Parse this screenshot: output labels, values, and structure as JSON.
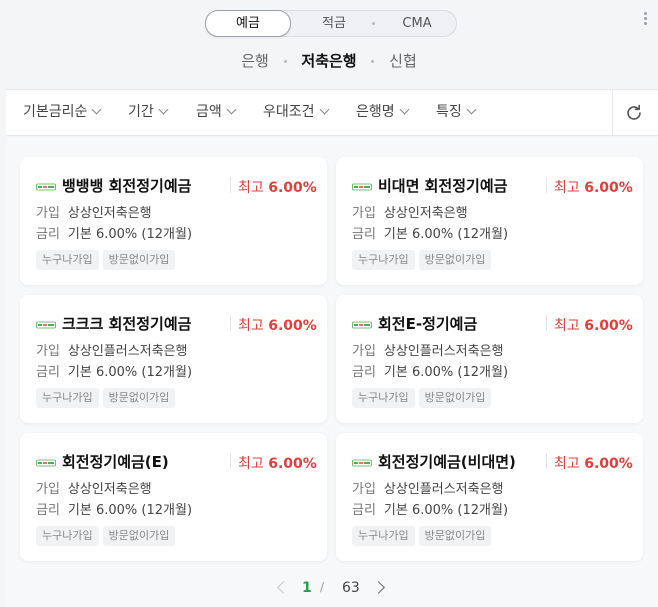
{
  "product_tabs": [
    {
      "label": "예금",
      "active": true
    },
    {
      "label": "적금",
      "active": false
    },
    {
      "label": "CMA",
      "active": false
    }
  ],
  "bank_types": [
    {
      "label": "은행",
      "selected": false
    },
    {
      "label": "저축은행",
      "selected": true
    },
    {
      "label": "신협",
      "selected": false
    }
  ],
  "filters": [
    "기본금리순",
    "기간",
    "금액",
    "우대조건",
    "은행명",
    "특징"
  ],
  "refresh_icon": "refresh-icon",
  "colors": {
    "accent_red": "#e0403a",
    "accent_green": "#2a9d4e"
  },
  "cards": [
    {
      "title": "뱅뱅뱅 회전정기예금",
      "rate_prefix": "최고",
      "rate": "6.00%",
      "join_label": "가입",
      "bank": "상상인저축은행",
      "rate_label": "금리",
      "base": "기본 6.00% (12개월)",
      "tags": [
        "누구나가입",
        "방문없이가입"
      ]
    },
    {
      "title": "비대면 회전정기예금",
      "rate_prefix": "최고",
      "rate": "6.00%",
      "join_label": "가입",
      "bank": "상상인저축은행",
      "rate_label": "금리",
      "base": "기본 6.00% (12개월)",
      "tags": [
        "누구나가입",
        "방문없이가입"
      ]
    },
    {
      "title": "크크크 회전정기예금",
      "rate_prefix": "최고",
      "rate": "6.00%",
      "join_label": "가입",
      "bank": "상상인플러스저축은행",
      "rate_label": "금리",
      "base": "기본 6.00% (12개월)",
      "tags": [
        "누구나가입",
        "방문없이가입"
      ]
    },
    {
      "title": "회전E-정기예금",
      "rate_prefix": "최고",
      "rate": "6.00%",
      "join_label": "가입",
      "bank": "상상인플러스저축은행",
      "rate_label": "금리",
      "base": "기본 6.00% (12개월)",
      "tags": [
        "누구나가입",
        "방문없이가입"
      ]
    },
    {
      "title": "회전정기예금(E)",
      "rate_prefix": "최고",
      "rate": "6.00%",
      "join_label": "가입",
      "bank": "상상인저축은행",
      "rate_label": "금리",
      "base": "기본 6.00% (12개월)",
      "tags": [
        "누구나가입",
        "방문없이가입"
      ]
    },
    {
      "title": "회전정기예금(비대면)",
      "rate_prefix": "최고",
      "rate": "6.00%",
      "join_label": "가입",
      "bank": "상상인플러스저축은행",
      "rate_label": "금리",
      "base": "기본 6.00% (12개월)",
      "tags": [
        "누구나가입",
        "방문없이가입"
      ]
    }
  ],
  "pagination": {
    "current": "1",
    "separator": "/",
    "total": "63"
  }
}
